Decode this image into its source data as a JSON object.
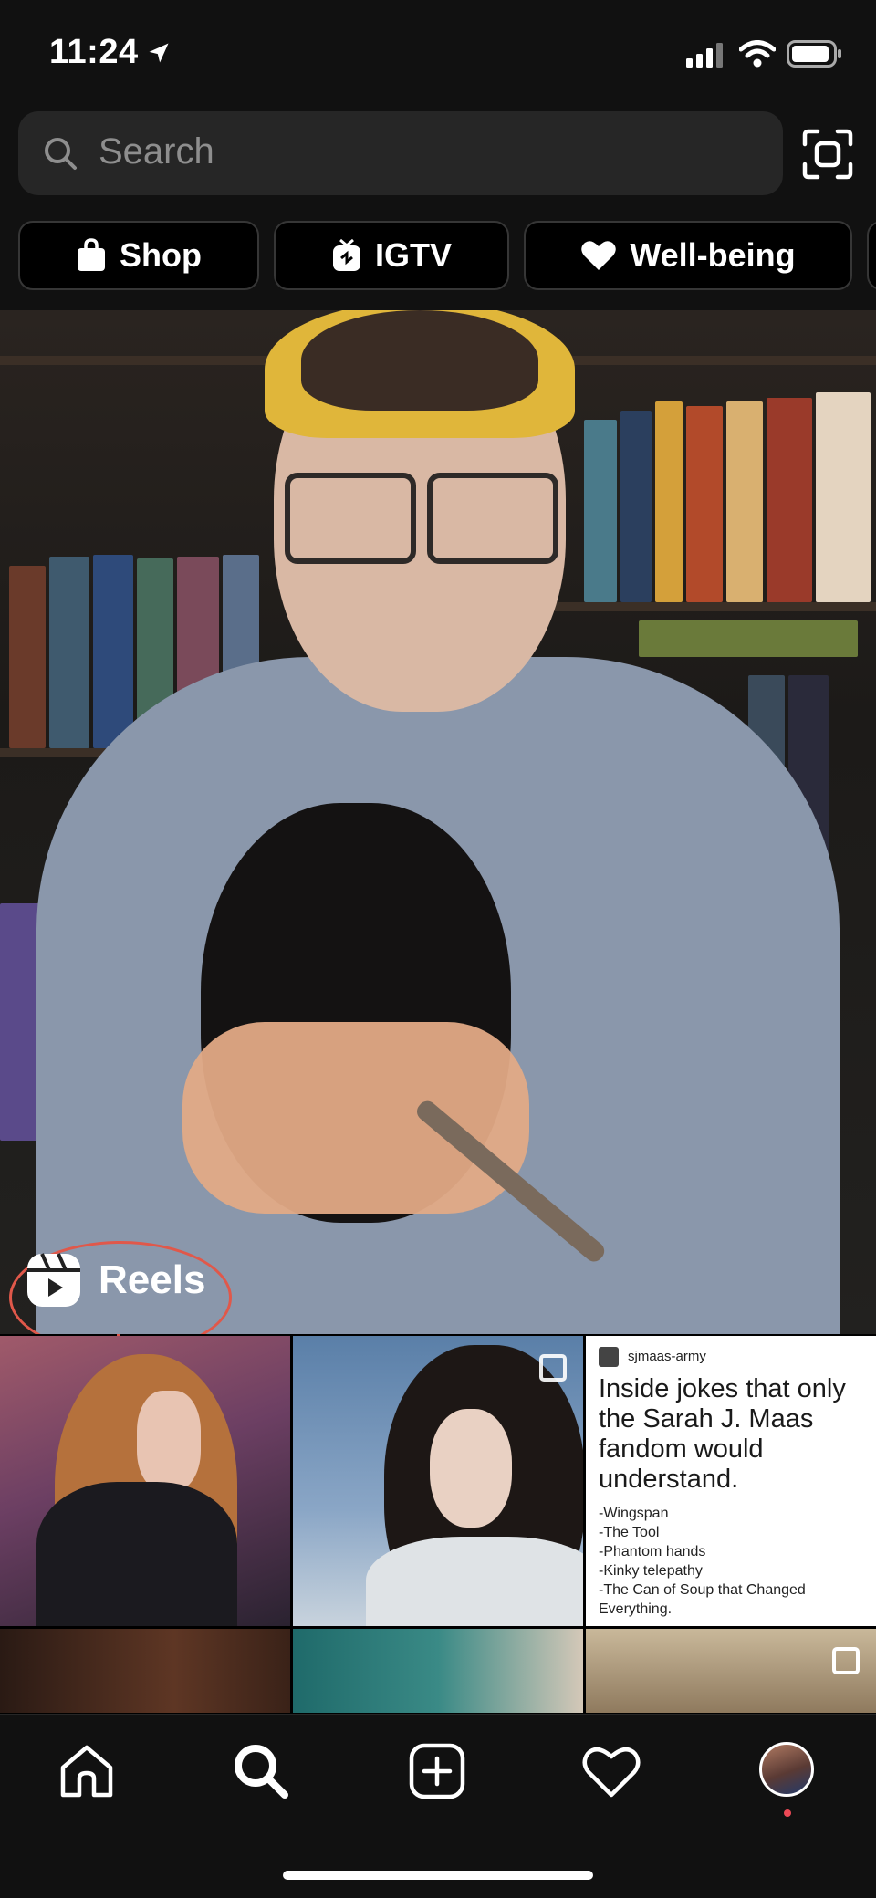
{
  "status_bar": {
    "time": "11:24"
  },
  "search": {
    "placeholder": "Search"
  },
  "chips": [
    {
      "label": "Shop",
      "icon": "shopping-bag-icon"
    },
    {
      "label": "IGTV",
      "icon": "igtv-icon"
    },
    {
      "label": "Well-being",
      "icon": "heart-icon"
    }
  ],
  "hero": {
    "reels_label": "Reels",
    "highlight_color": "#e0584a"
  },
  "grid": {
    "text_post": {
      "username": "sjmaas-army",
      "headline": "Inside jokes that only the Sarah J. Maas fandom would understand.",
      "bullets": [
        "-Wingspan",
        "-The Tool",
        "-Phantom hands",
        "-Kinky telepathy",
        "-The Can of Soup that Changed Everything."
      ]
    }
  },
  "tab_bar": {
    "items": [
      "home-icon",
      "search-icon",
      "new-post-icon",
      "activity-heart-icon",
      "profile-avatar"
    ],
    "notification_color": "#ed4956"
  },
  "colors": {
    "background": "#000000",
    "surface": "#262626",
    "placeholder": "#8e8e8e"
  }
}
